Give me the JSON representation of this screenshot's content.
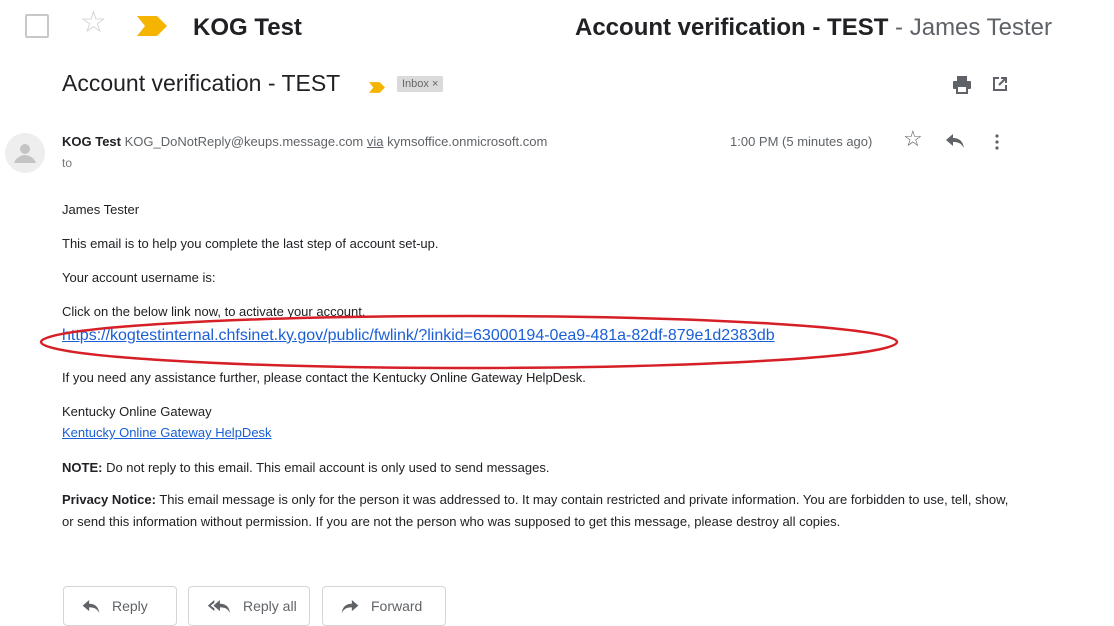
{
  "list_row": {
    "sender": "KOG Test",
    "subject": "Account verification - TEST",
    "separator": "-",
    "recipient": "James Tester"
  },
  "message": {
    "subject": "Account verification - TEST",
    "label": "Inbox ×",
    "sender_name": "KOG Test",
    "sender_email": "KOG_DoNotReply@keups.message.com",
    "via_word": "via",
    "via_domain": "kymsoffice.onmicrosoft.com",
    "to_label": "to",
    "time": "1:00 PM (5 minutes ago)"
  },
  "body": {
    "greeting": "James Tester",
    "line1": "This email is to help you complete the last step of account set-up.",
    "line2": "Your account username is:",
    "line3": "Click on the below link now, to activate your account.",
    "activation_link": "https://kogtestinternal.chfsinet.ky.gov/public/fwlink/?linkid=63000194-0ea9-481a-82df-879e1d2383db",
    "line4": "If you need any assistance further, please contact the Kentucky Online Gateway HelpDesk.",
    "org_name": "Kentucky Online Gateway",
    "helpdesk_link": "Kentucky Online Gateway HelpDesk",
    "note_label": "NOTE:",
    "note_text": " Do not reply to this email. This email account is only used to send messages.",
    "privacy_label": "Privacy Notice:",
    "privacy_text": " This email message is only for the person it was addressed to. It may contain restricted and private information. You are forbidden to use, tell, show, or send this information without permission. If you are not the person who was supposed to get this message, please destroy all copies."
  },
  "actions": {
    "reply": "Reply",
    "reply_all": "Reply all",
    "forward": "Forward"
  },
  "icons": {
    "checkbox": "checkbox-icon",
    "star": "star-icon",
    "importance": "importance-marker-icon",
    "print": "print-icon",
    "open_new_window": "open-in-new-window-icon",
    "avatar": "default-avatar-icon",
    "reply": "reply-icon",
    "reply_all": "reply-all-icon",
    "forward": "forward-icon",
    "more": "more-vert-icon"
  },
  "colors": {
    "importance": "#f5b400",
    "link": "#1a5fd6",
    "annotation": "#d61f26"
  }
}
